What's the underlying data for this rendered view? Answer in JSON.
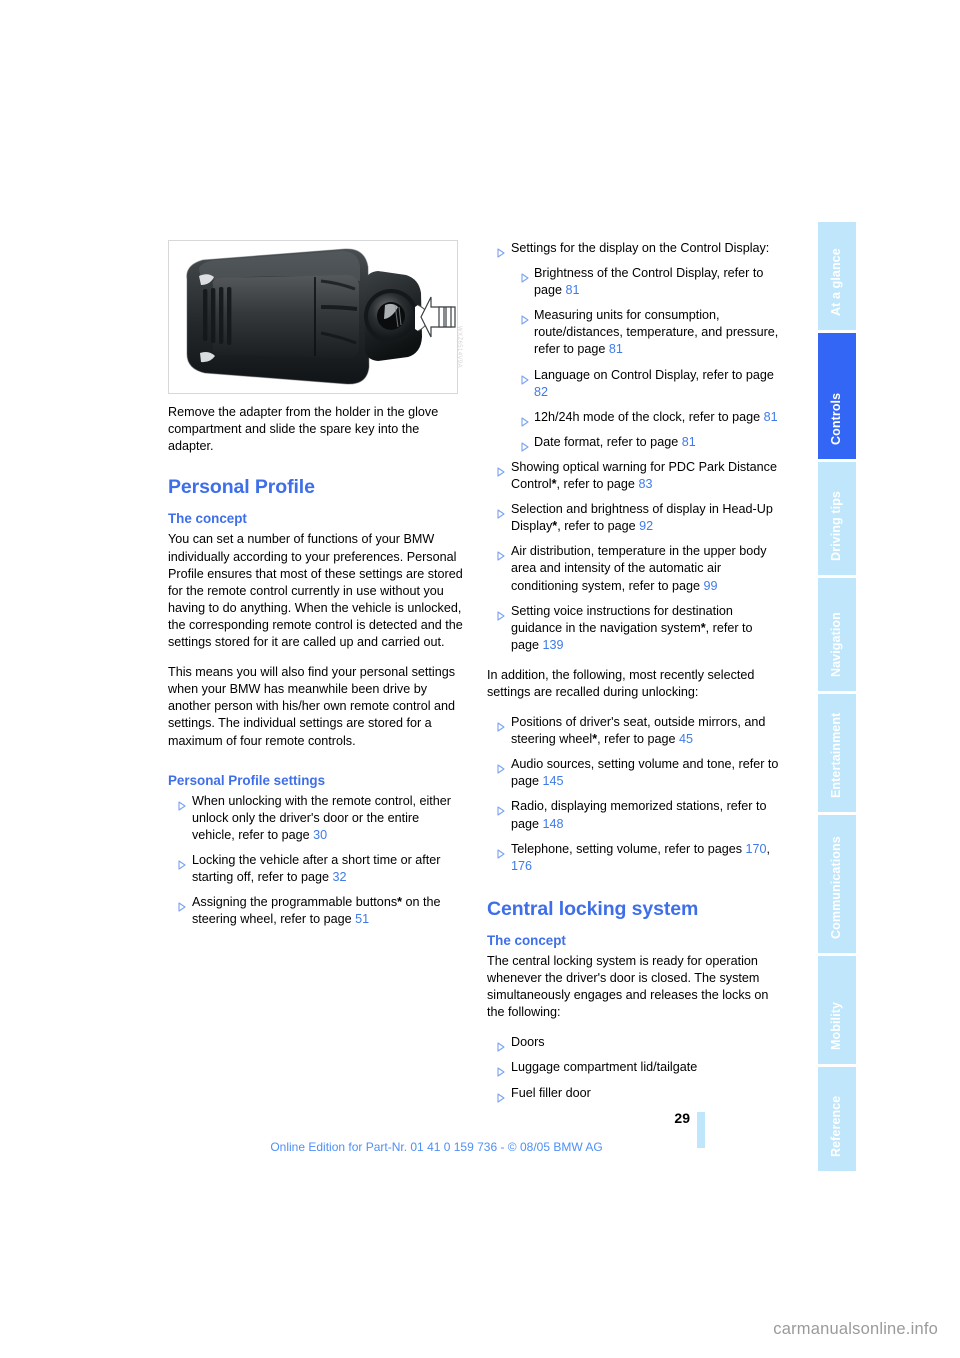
{
  "document": {
    "page_number": "29",
    "edition_line": "Online Edition for Part-Nr. 01 41 0 159 736 - © 08/05 BMW AG",
    "watermark": "carmanualsonline.info"
  },
  "tabs": [
    {
      "label": "At a glance",
      "active": false
    },
    {
      "label": "Controls",
      "active": true
    },
    {
      "label": "Driving tips",
      "active": false
    },
    {
      "label": "Navigation",
      "active": false
    },
    {
      "label": "Entertainment",
      "active": false
    },
    {
      "label": "Communications",
      "active": false
    },
    {
      "label": "Mobility",
      "active": false
    },
    {
      "label": "Reference",
      "active": false
    }
  ],
  "figure": {
    "alt": "BMW remote control key with adapter and spare key, arrow indicating insertion direction",
    "code": "WXZ6514V9A",
    "caption": "Remove the adapter from the holder in the glove compartment and slide the spare key into the adapter."
  },
  "left_column": {
    "section_title": "Personal Profile",
    "concept_heading": "The concept",
    "concept_paragraphs": [
      "You can set a number of functions of your BMW individually according to your preferences. Personal Profile ensures that most of these settings are stored for the remote control currently in use without you having to do anything. When the vehicle is unlocked, the corresponding remote control is detected and the settings stored for it are called up and carried out.",
      "This means you will also find your personal settings when your BMW has meanwhile been drive by another person with his/her own remote control and settings. The individual settings are stored for a maximum of four remote controls."
    ],
    "settings_heading": "Personal Profile settings",
    "settings_items": [
      {
        "text_before": "When unlocking with the remote control, either unlock only the driver's door or the entire vehicle, refer to page ",
        "page": "30",
        "text_after": ""
      },
      {
        "text_before": "Locking the vehicle after a short time or after starting off, refer to page ",
        "page": "32",
        "text_after": ""
      },
      {
        "text_before": "Assigning the programmable buttons",
        "star": "*",
        "text_mid": " on the steering wheel, refer to page ",
        "page": "51",
        "text_after": ""
      }
    ]
  },
  "right_column": {
    "display_settings_item": "Settings for the display on the Control Display:",
    "display_sub_items": [
      {
        "text_before": "Brightness of the Control Display, refer to page ",
        "page": "81",
        "text_after": ""
      },
      {
        "text_before": "Measuring units for consumption, route/distances, temperature, and pressure, refer to page ",
        "page": "81",
        "text_after": ""
      },
      {
        "text_before": "Language on Control Display, refer to page ",
        "page": "82",
        "text_after": ""
      },
      {
        "text_before": "12h/24h mode of the clock, refer to page ",
        "page": "81",
        "text_after": ""
      },
      {
        "text_before": "Date format, refer to page ",
        "page": "81",
        "text_after": ""
      }
    ],
    "more_items": [
      {
        "text_before": "Showing optical warning for PDC Park Distance Control",
        "star": "*",
        "text_mid": ", refer to page ",
        "page": "83",
        "text_after": ""
      },
      {
        "text_before": "Selection and brightness of display in Head-Up Display",
        "star": "*",
        "text_mid": ", refer to page ",
        "page": "92",
        "text_after": ""
      },
      {
        "text_before": "Air distribution, temperature in the upper body area and intensity of the automatic air conditioning system, refer to page ",
        "page": "99",
        "text_after": ""
      },
      {
        "text_before": "Setting voice instructions for destination guidance in the navigation system",
        "star": "*",
        "text_mid": ", refer to page ",
        "page": "139",
        "text_after": ""
      }
    ],
    "addition_paragraph": "In addition, the following, most recently selected settings are recalled during unlocking:",
    "recall_items": [
      {
        "text_before": "Positions of driver's seat, outside mirrors, and steering wheel",
        "star": "*",
        "text_mid": ", refer to page ",
        "page": "45",
        "text_after": ""
      },
      {
        "text_before": "Audio sources, setting volume and tone, refer to page ",
        "page": "145",
        "text_after": ""
      },
      {
        "text_before": "Radio, displaying memorized stations, refer to page ",
        "page": "148",
        "text_after": ""
      },
      {
        "text_before": "Telephone, setting volume, refer to pages ",
        "page": "170",
        "text_mid2": ", ",
        "page2": "176",
        "text_after": ""
      }
    ],
    "central_title": "Central locking system",
    "central_concept_heading": "The concept",
    "central_concept_paragraph": "The central locking system is ready for operation whenever the driver's door is closed. The system simultaneously engages and releases the locks on the following:",
    "central_items": [
      {
        "text_before": "Doors"
      },
      {
        "text_before": "Luggage compartment lid/tailgate"
      },
      {
        "text_before": "Fuel filler door"
      }
    ]
  },
  "colors": {
    "heading_blue": "#3f6fe8",
    "link_blue": "#3f7be8",
    "tab_inactive": "#bfe6fb",
    "tab_active": "#3366f5",
    "footer_blue": "#4f8ff5"
  }
}
